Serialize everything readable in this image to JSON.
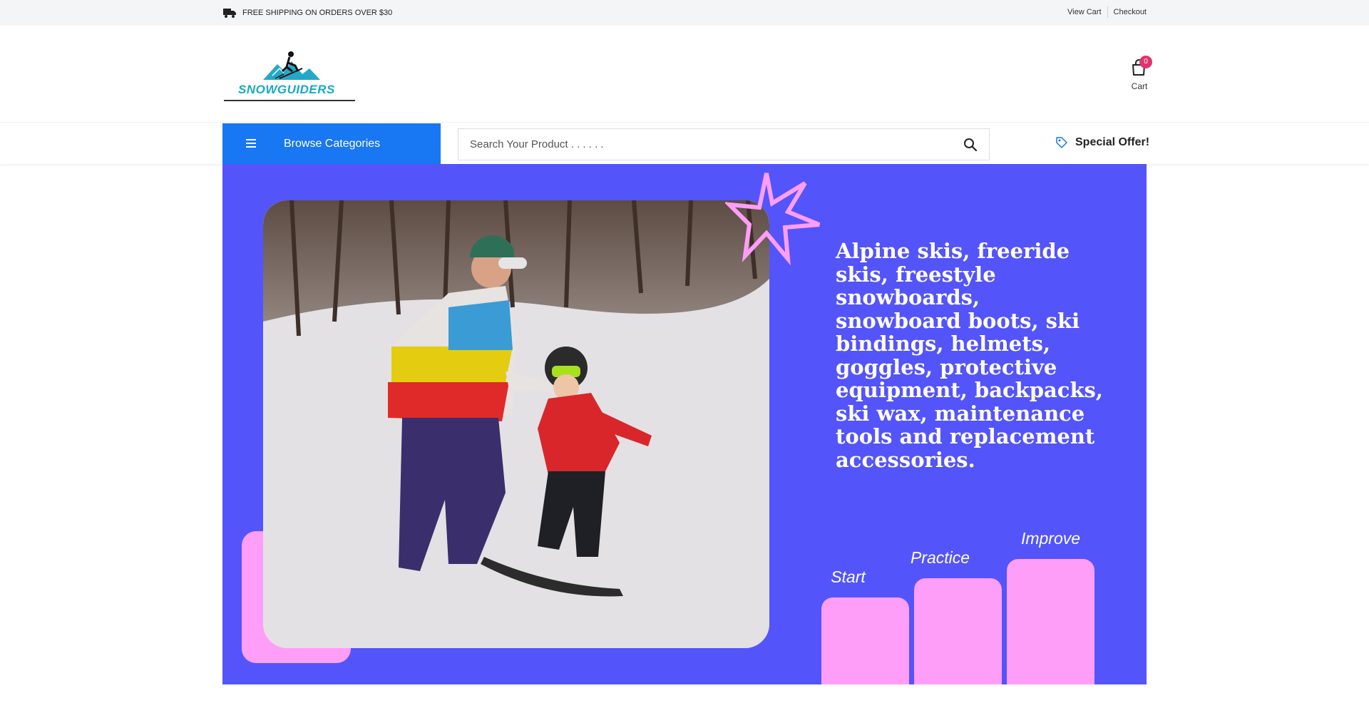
{
  "topbar": {
    "shipping_text": "FREE SHIPPING ON ORDERS OVER $30",
    "shipping_icon": "truck-icon",
    "view_cart": "View Cart",
    "checkout": "Checkout"
  },
  "header": {
    "logo_text": "SNOWGUIDERS",
    "cart_count": "0",
    "cart_label": "Cart",
    "cart_icon": "shopping-bag-icon"
  },
  "nav": {
    "browse_label": "Browse Categories",
    "menu_icon": "hamburger-icon",
    "search_placeholder": "Search Your Product . . . . . .",
    "search_icon": "search-icon",
    "special_offer": "Special Offer!",
    "special_icon": "tag-icon"
  },
  "hero": {
    "headline": "Alpine skis, freeride skis, freestyle snowboards, snowboard boots, ski bindings, helmets, goggles, protective equipment, backpacks, ski wax, maintenance tools and replacement accessories.",
    "steps": [
      "Start",
      "Practice",
      "Improve"
    ],
    "colors": {
      "background": "#5454fb",
      "accent": "#ff9ef8"
    }
  }
}
